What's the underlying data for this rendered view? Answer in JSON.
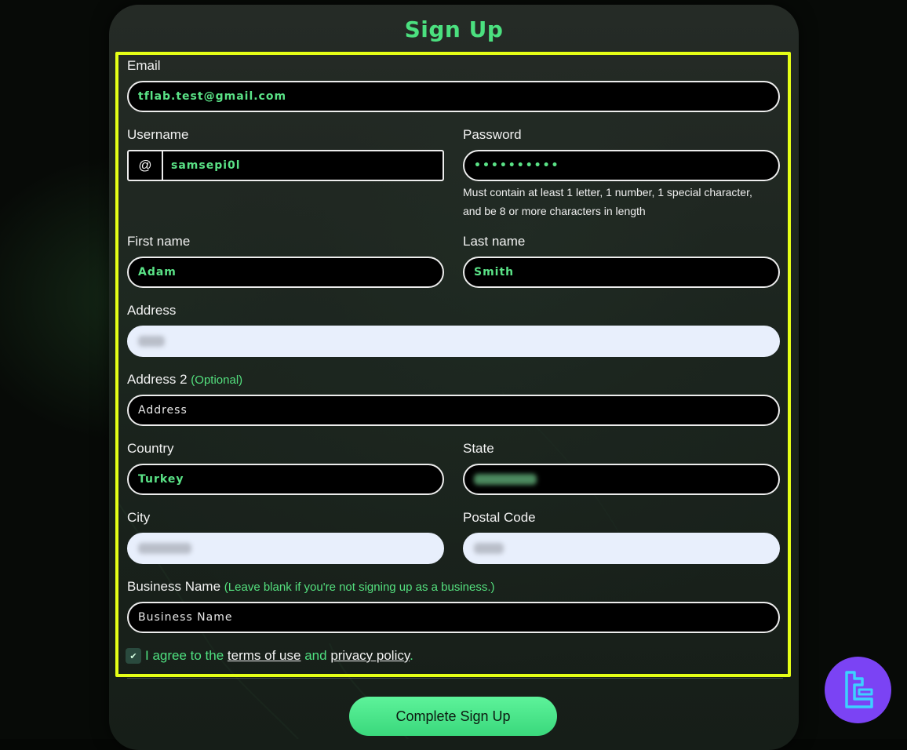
{
  "form": {
    "title": "Sign Up",
    "email": {
      "label": "Email",
      "value": "tflab.test@gmail.com"
    },
    "username": {
      "label": "Username",
      "prefix": "@",
      "value": "samsepi0l"
    },
    "password": {
      "label": "Password",
      "value": "••••••••••",
      "hint": "Must contain at least 1 letter, 1 number, 1 special character, and be 8 or more characters in length"
    },
    "first_name": {
      "label": "First name",
      "value": "Adam"
    },
    "last_name": {
      "label": "Last name",
      "value": "Smith"
    },
    "address": {
      "label": "Address"
    },
    "address2": {
      "label": "Address 2",
      "optional": "(Optional)",
      "placeholder": "Address"
    },
    "country": {
      "label": "Country",
      "value": "Turkey"
    },
    "state": {
      "label": "State"
    },
    "city": {
      "label": "City"
    },
    "postal_code": {
      "label": "Postal Code"
    },
    "business_name": {
      "label": "Business Name",
      "note": "(Leave blank if you're not signing up as a business.)",
      "placeholder": "Business Name"
    },
    "agree": {
      "prefix": "I agree to the",
      "terms": "terms of use",
      "and": "and",
      "privacy": "privacy policy",
      "suffix": ".",
      "checked": true
    },
    "submit_label": "Complete Sign Up"
  },
  "colors": {
    "accent_green": "#4be07f",
    "highlight": "#e5ff16",
    "logo_bg": "#7b43f4"
  },
  "icons": {
    "checkbox": "check-icon",
    "logo": "tf-logo-icon"
  }
}
